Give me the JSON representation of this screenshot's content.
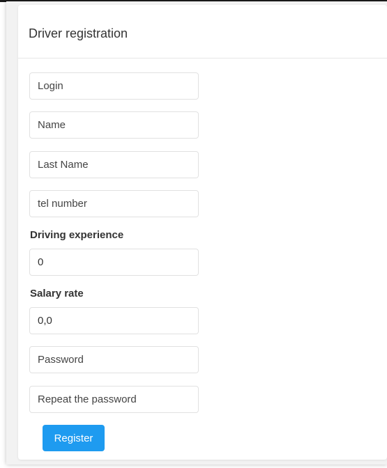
{
  "form": {
    "title": "Driver registration",
    "login": {
      "placeholder": "Login",
      "value": ""
    },
    "name": {
      "placeholder": "Name",
      "value": ""
    },
    "last_name": {
      "placeholder": "Last Name",
      "value": ""
    },
    "tel_number": {
      "placeholder": "tel number",
      "value": ""
    },
    "driving_experience": {
      "label": "Driving experience",
      "value": "0"
    },
    "salary_rate": {
      "label": "Salary rate",
      "value": "0,0"
    },
    "password": {
      "placeholder": "Password",
      "value": ""
    },
    "repeat_password": {
      "placeholder": "Repeat the password",
      "value": ""
    },
    "register_label": "Register"
  },
  "colors": {
    "accent": "#1e9bf0",
    "background": "#f2f2f2",
    "panel": "#ffffff",
    "text": "#333333"
  }
}
